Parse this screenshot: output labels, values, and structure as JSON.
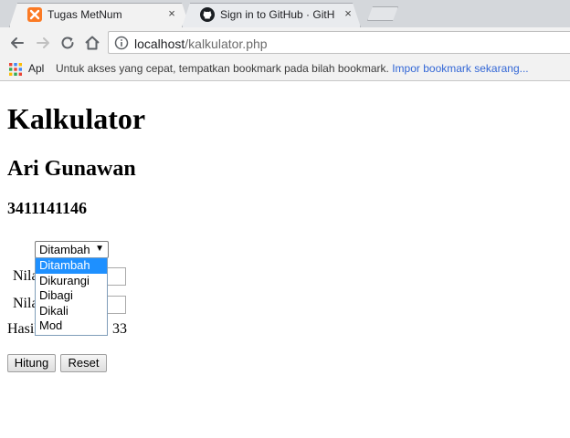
{
  "browser": {
    "tabs": [
      {
        "title": "Tugas MetNum",
        "icon": "xampp-icon",
        "active": true
      },
      {
        "title": "Sign in to GitHub · GitHub",
        "icon": "github-icon",
        "active": false
      }
    ],
    "close_glyph": "×",
    "address": {
      "host": "localhost",
      "path": "/kalkulator.php"
    },
    "bookmarks": {
      "apps_label": "Apl",
      "hint": "Untuk akses yang cepat, tempatkan bookmark pada bilah bookmark.",
      "import_link": "Impor bookmark sekarang..."
    }
  },
  "page": {
    "title": "Kalkulator",
    "name": "Ari Gunawan",
    "nim": "3411141146",
    "operation_select": {
      "value": "Ditambah",
      "options": [
        "Ditambah",
        "Dikurangi",
        "Dibagi",
        "Dikali",
        "Mod"
      ],
      "highlighted": "Ditambah"
    },
    "nilai1_label": "Nilai 1",
    "nilai2_label": "Nilai 2",
    "nilai1_value": "",
    "nilai2_value": "",
    "result_label": "Hasil",
    "result_value": "33",
    "buttons": {
      "hitung": "Hitung",
      "reset": "Reset"
    }
  },
  "colors": {
    "accent_link": "#3367d6",
    "option_highlight": "#1e90ff",
    "xampp_orange": "#fb7a24"
  }
}
